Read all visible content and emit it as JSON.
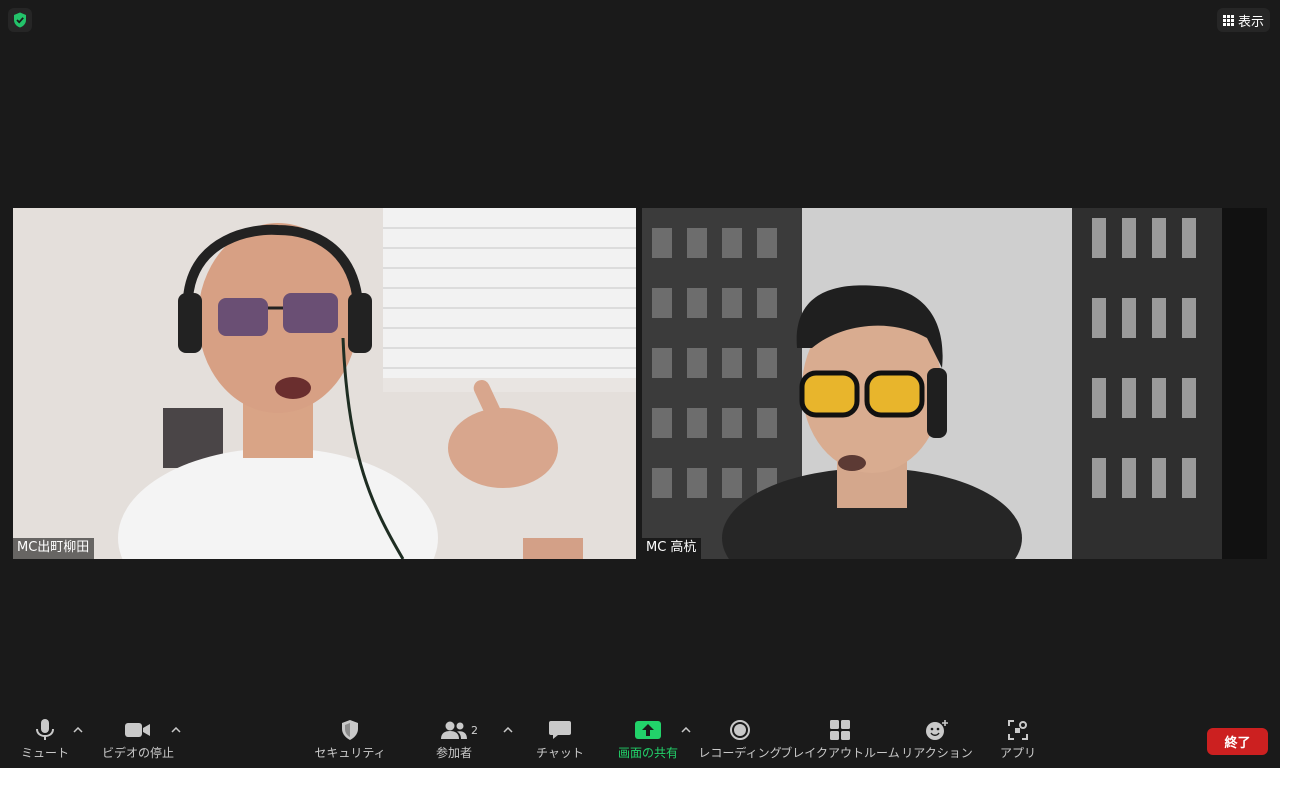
{
  "top": {
    "view_label": "表示"
  },
  "participants": [
    {
      "name": "MC出町柳田"
    },
    {
      "name": "MC 高杭"
    }
  ],
  "toolbar": {
    "mute": "ミュート",
    "video": "ビデオの停止",
    "security": "セキュリティ",
    "participants": "参加者",
    "participant_count": "2",
    "chat": "チャット",
    "share": "画面の共有",
    "record": "レコーディング",
    "breakout": "ブレイクアウトルーム",
    "reactions": "リアクション",
    "apps": "アプリ",
    "end": "終了"
  },
  "colors": {
    "share_accent": "#22d26a",
    "end_button": "#cc2020",
    "security_badge": "#23c36a"
  }
}
